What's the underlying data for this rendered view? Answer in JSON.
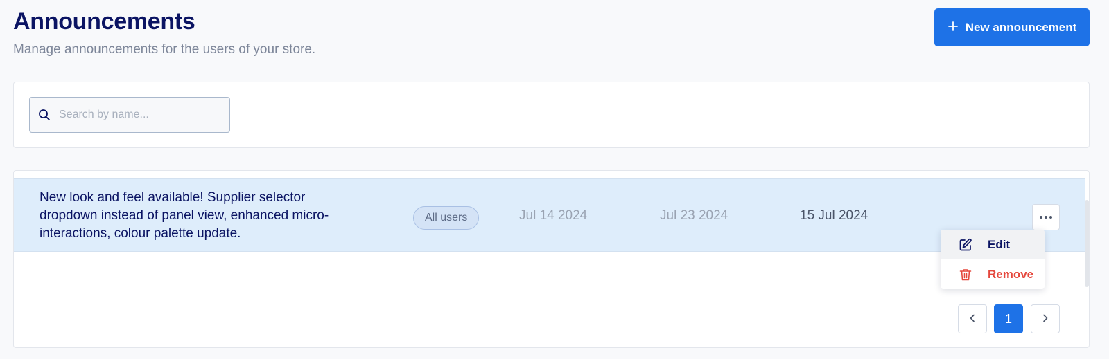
{
  "header": {
    "title": "Announcements",
    "subtitle": "Manage announcements for the users of your store.",
    "new_button_icon": "plus-icon",
    "new_button_label": "New announcement"
  },
  "search": {
    "icon": "search-icon",
    "placeholder": "Search by name..."
  },
  "table": {
    "rows": [
      {
        "title": "New look and feel available! Supplier selector dropdown instead of panel view, enhanced micro-interactions, colour palette update.",
        "audience": "All users",
        "start_date": "Jul 14 2024",
        "end_date": "Jul 23 2024",
        "created_date": "15 Jul 2024",
        "actions_icon": "more-horizontal-icon"
      }
    ]
  },
  "row_menu": {
    "items": [
      {
        "label": "Edit",
        "icon": "pencil-icon"
      },
      {
        "label": "Remove",
        "icon": "trash-icon"
      }
    ]
  },
  "pagination": {
    "current_page": "1",
    "prev_icon": "chevron-left-icon",
    "next_icon": "chevron-right-icon"
  },
  "colors": {
    "accent": "#1e72e7",
    "title": "#0b1463",
    "danger": "#e5473c",
    "row_highlight": "#deedfb"
  }
}
